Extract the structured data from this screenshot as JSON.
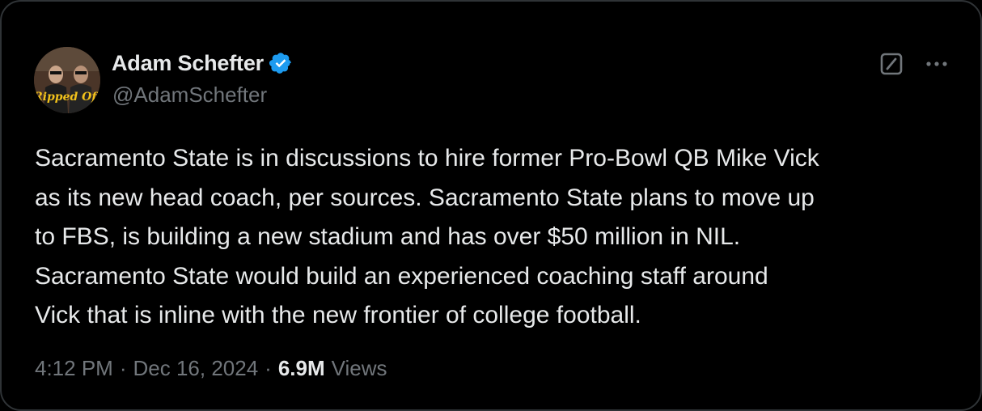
{
  "author": {
    "name": "Adam Schefter",
    "handle": "@AdamSchefter",
    "verified": true,
    "avatar_caption": "Ripped Off",
    "verified_color": "#1d9bf0"
  },
  "actions": {
    "grok_icon": "grok-slash-icon",
    "more_icon": "more-dots-icon"
  },
  "tweet": {
    "text": "Sacramento State is in discussions to hire former Pro-Bowl QB Mike Vick\nas its new head coach, per sources. Sacramento State plans to move up\nto FBS, is building a new stadium and has over $50 million in NIL.\nSacramento State would build an experienced coaching staff around\nVick that is inline with the new frontier of college football."
  },
  "meta": {
    "time": "4:12 PM",
    "date": "Dec 16, 2024",
    "views_count": "6.9M",
    "views_label": "Views",
    "separator": "·"
  }
}
